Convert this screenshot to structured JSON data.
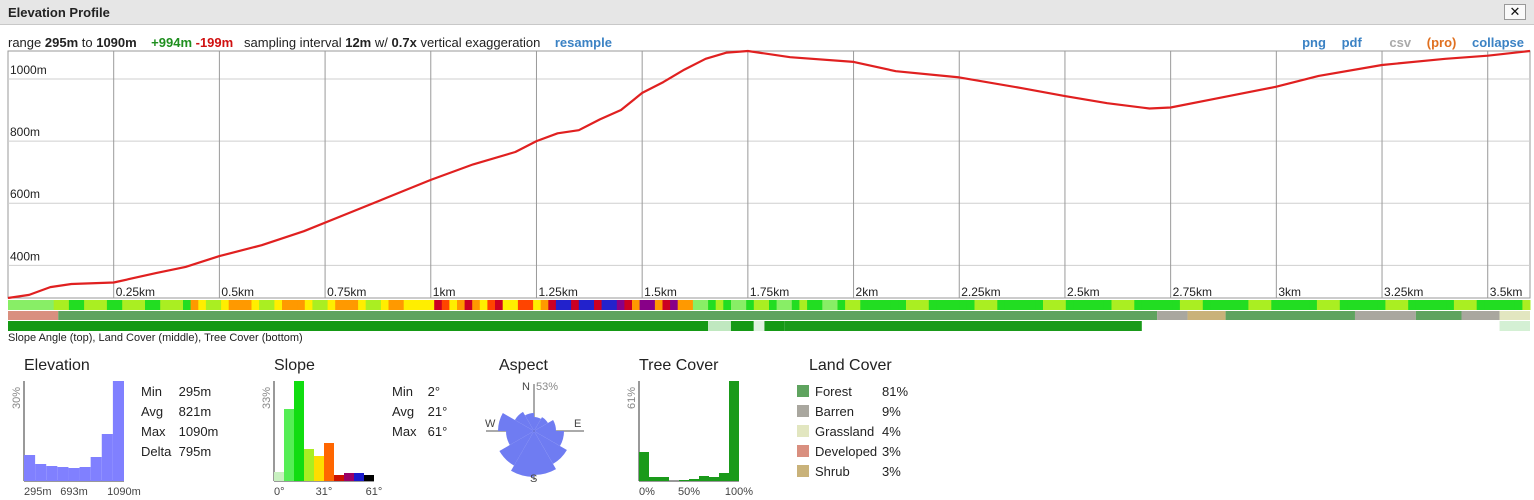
{
  "window": {
    "title": "Elevation Profile",
    "close_label": "✕"
  },
  "infobar": {
    "range_prefix": "range",
    "min": "295m",
    "to": "to",
    "max": "1090m",
    "gain": "+994m",
    "loss": "-199m",
    "interval_prefix": "sampling interval",
    "interval": "12m",
    "w": "w/",
    "exaggeration": "0.7x",
    "exaggeration_suffix": "vertical exaggeration",
    "resample": "resample"
  },
  "actions": {
    "png": "png",
    "pdf": "pdf",
    "csv": "csv",
    "pro": "(pro)",
    "collapse": "collapse"
  },
  "colors": {
    "line": "#e02020",
    "grid": "#999999",
    "forest": "#5fa35f",
    "barren": "#a9a79f",
    "grassland": "#e2e6c0",
    "developed": "#d98f7f",
    "shrub": "#c9b27a",
    "histogram": "#8080ff",
    "tree": "#1a9a1a"
  },
  "chart_data": {
    "type": "line",
    "xlabel": "",
    "ylabel": "",
    "xlim": [
      0,
      3.6
    ],
    "ylim": [
      295,
      1090
    ],
    "x_ticks": [
      {
        "v": 0.25,
        "label": "0.25km"
      },
      {
        "v": 0.5,
        "label": "0.5km"
      },
      {
        "v": 0.75,
        "label": "0.75km"
      },
      {
        "v": 1.0,
        "label": "1km"
      },
      {
        "v": 1.25,
        "label": "1.25km"
      },
      {
        "v": 1.5,
        "label": "1.5km"
      },
      {
        "v": 1.75,
        "label": "1.75km"
      },
      {
        "v": 2.0,
        "label": "2km"
      },
      {
        "v": 2.25,
        "label": "2.25km"
      },
      {
        "v": 2.5,
        "label": "2.5km"
      },
      {
        "v": 2.75,
        "label": "2.75km"
      },
      {
        "v": 3.0,
        "label": "3km"
      },
      {
        "v": 3.25,
        "label": "3.25km"
      },
      {
        "v": 3.5,
        "label": "3.5km"
      }
    ],
    "y_ticks": [
      {
        "v": 400,
        "label": "400m"
      },
      {
        "v": 600,
        "label": "600m"
      },
      {
        "v": 800,
        "label": "800m"
      },
      {
        "v": 1000,
        "label": "1000m"
      }
    ],
    "series": [
      {
        "x": [
          0,
          0.05,
          0.1,
          0.15,
          0.25,
          0.35,
          0.42,
          0.5,
          0.6,
          0.7,
          0.8,
          0.9,
          1.0,
          1.1,
          1.2,
          1.25,
          1.3,
          1.35,
          1.4,
          1.45,
          1.5,
          1.55,
          1.6,
          1.65,
          1.7,
          1.75,
          1.85,
          2.0,
          2.1,
          2.25,
          2.4,
          2.5,
          2.6,
          2.7,
          2.75,
          2.85,
          3.0,
          3.1,
          3.25,
          3.4,
          3.5,
          3.6
        ],
        "y": [
          295,
          305,
          330,
          340,
          345,
          375,
          395,
          430,
          465,
          510,
          565,
          620,
          675,
          725,
          765,
          800,
          825,
          835,
          870,
          900,
          955,
          990,
          1030,
          1065,
          1085,
          1090,
          1070,
          1055,
          1025,
          1005,
          970,
          945,
          922,
          905,
          908,
          935,
          975,
          1010,
          1045,
          1065,
          1075,
          1090
        ]
      }
    ]
  },
  "strip_caption": "Slope Angle (top), Land Cover (middle), Tree Cover (bottom)",
  "elevation": {
    "title": "Elevation",
    "ymax_label": "30%",
    "x_labels": [
      "295m",
      "693m",
      "1090m"
    ],
    "bins": [
      0.26,
      0.17,
      0.15,
      0.14,
      0.13,
      0.14,
      0.24,
      0.47,
      1.0
    ],
    "stats": [
      {
        "label": "Min",
        "value": "295m"
      },
      {
        "label": "Avg",
        "value": "821m"
      },
      {
        "label": "Max",
        "value": "1090m"
      },
      {
        "label": "Delta",
        "value": "795m"
      }
    ]
  },
  "slope": {
    "title": "Slope",
    "ymax_label": "33%",
    "x_labels": [
      "0°",
      "31°",
      "61°"
    ],
    "bins": [
      {
        "v": 0.09,
        "c": "#c8f0c0"
      },
      {
        "v": 0.72,
        "c": "#55ee55"
      },
      {
        "v": 1.0,
        "c": "#11dd11"
      },
      {
        "v": 0.32,
        "c": "#aaee22"
      },
      {
        "v": 0.25,
        "c": "#ffdd00"
      },
      {
        "v": 0.38,
        "c": "#ff6600"
      },
      {
        "v": 0.06,
        "c": "#cc1100"
      },
      {
        "v": 0.08,
        "c": "#990066"
      },
      {
        "v": 0.08,
        "c": "#1a1acc"
      },
      {
        "v": 0.06,
        "c": "#000000"
      }
    ],
    "stats": [
      {
        "label": "Min",
        "value": "2°"
      },
      {
        "label": "Avg",
        "value": "21°"
      },
      {
        "label": "Max",
        "value": "61°"
      }
    ]
  },
  "aspect": {
    "title": "Aspect",
    "north": "N",
    "north_pct": "53%",
    "west": "W",
    "east": "E",
    "south": "S"
  },
  "tree_cover": {
    "title": "Tree Cover",
    "ymax_label": "61%",
    "x_labels": [
      "0%",
      "50%",
      "100%"
    ],
    "bins": [
      0.29,
      0.04,
      0.04,
      0.0,
      0.01,
      0.02,
      0.05,
      0.04,
      0.08,
      1.0
    ]
  },
  "land_cover": {
    "title": "Land Cover",
    "items": [
      {
        "label": "Forest",
        "pct": "81%",
        "color": "#5fa35f"
      },
      {
        "label": "Barren",
        "pct": "9%",
        "color": "#a9a79f"
      },
      {
        "label": "Grassland",
        "pct": "4%",
        "color": "#e2e6c0"
      },
      {
        "label": "Developed",
        "pct": "3%",
        "color": "#d98f7f"
      },
      {
        "label": "Shrub",
        "pct": "3%",
        "color": "#c9b27a"
      }
    ]
  }
}
